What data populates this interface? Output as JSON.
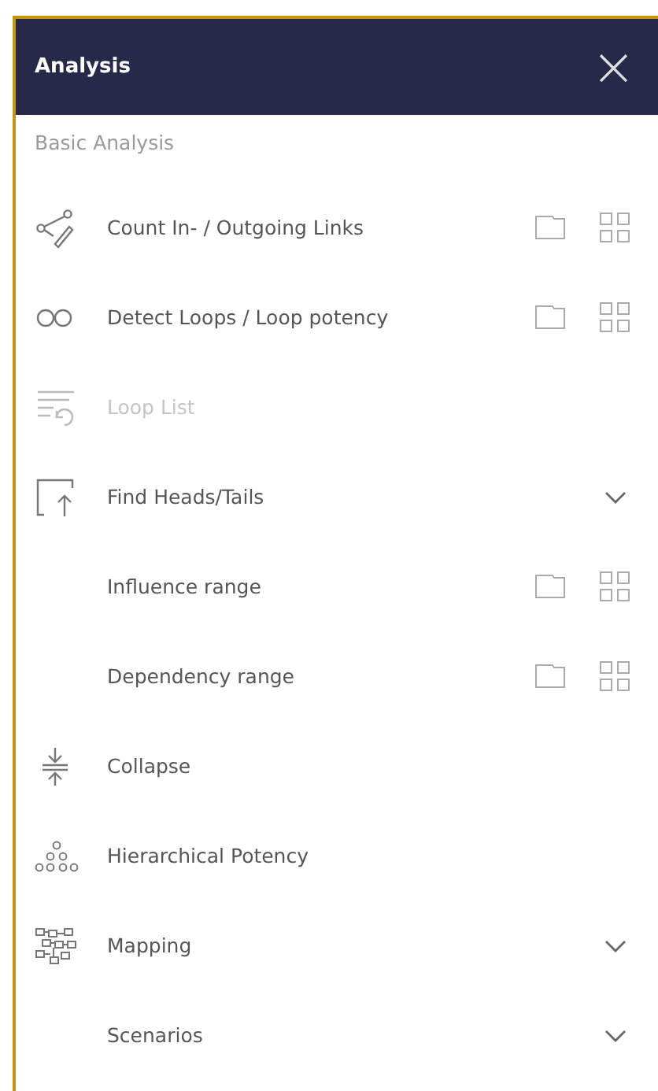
{
  "header": {
    "title": "Analysis",
    "close": "×"
  },
  "section": "Basic Analysis",
  "items": [
    {
      "label": "Count In- / Outgoing Links",
      "kind": "action",
      "disabled": false
    },
    {
      "label": "Detect Loops / Loop potency",
      "kind": "action",
      "disabled": false
    },
    {
      "label": "Loop List",
      "kind": "plain",
      "disabled": true
    },
    {
      "label": "Find Heads/Tails",
      "kind": "group",
      "disabled": false,
      "children": [
        {
          "label": "Influence range",
          "kind": "action",
          "disabled": false
        },
        {
          "label": "Dependency range",
          "kind": "action",
          "disabled": false
        }
      ]
    },
    {
      "label": "Collapse",
      "kind": "plain",
      "disabled": false
    },
    {
      "label": "Hierarchical Potency",
      "kind": "plain",
      "disabled": false
    },
    {
      "label": "Mapping",
      "kind": "group",
      "disabled": false
    },
    {
      "label": "Scenarios",
      "kind": "group",
      "disabled": false
    }
  ]
}
